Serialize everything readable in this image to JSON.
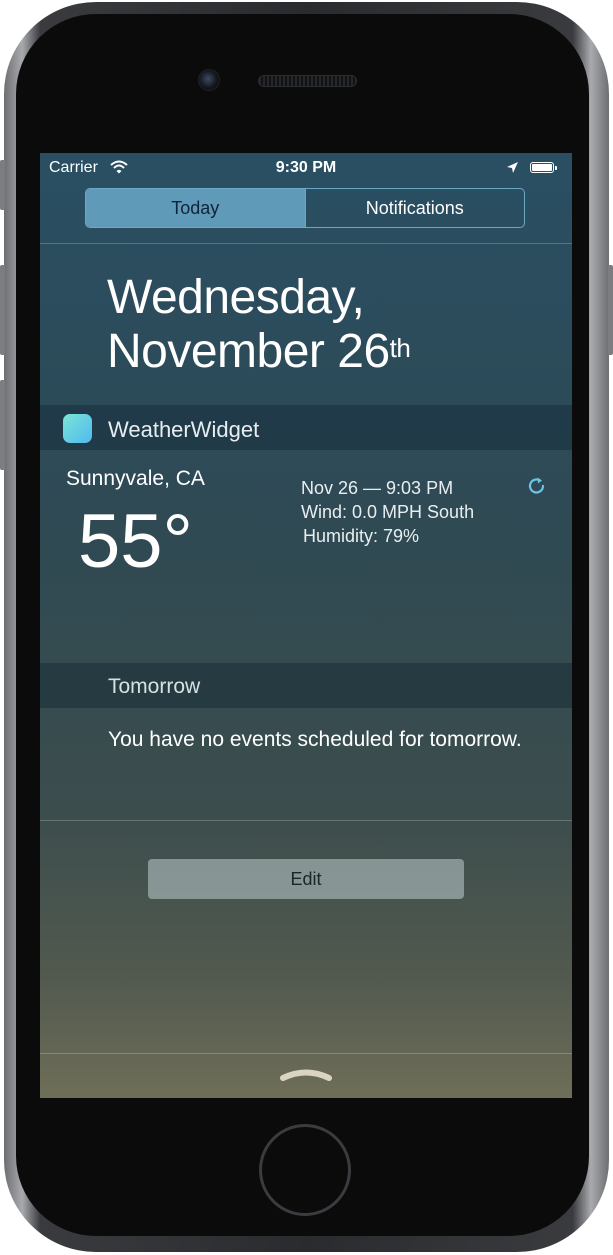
{
  "status_bar": {
    "carrier": "Carrier",
    "time": "9:30 PM"
  },
  "tabs": [
    {
      "label": "Today",
      "selected": true
    },
    {
      "label": "Notifications",
      "selected": false
    }
  ],
  "today": {
    "weekday": "Wednesday,",
    "date": "November 26",
    "date_suffix": "th"
  },
  "widget": {
    "name": "WeatherWidget",
    "location": "Sunnyvale, CA",
    "temperature": "55°",
    "updated": "Nov 26 — 9:03 PM",
    "wind": "Wind: 0.0 MPH South",
    "humidity": "Humidity: 79%"
  },
  "tomorrow": {
    "title": "Tomorrow",
    "message": "You have no events scheduled for tomorrow."
  },
  "edit_label": "Edit",
  "colors": {
    "accent": "#5f9ab8",
    "app_icon": "#4fb9ef"
  }
}
